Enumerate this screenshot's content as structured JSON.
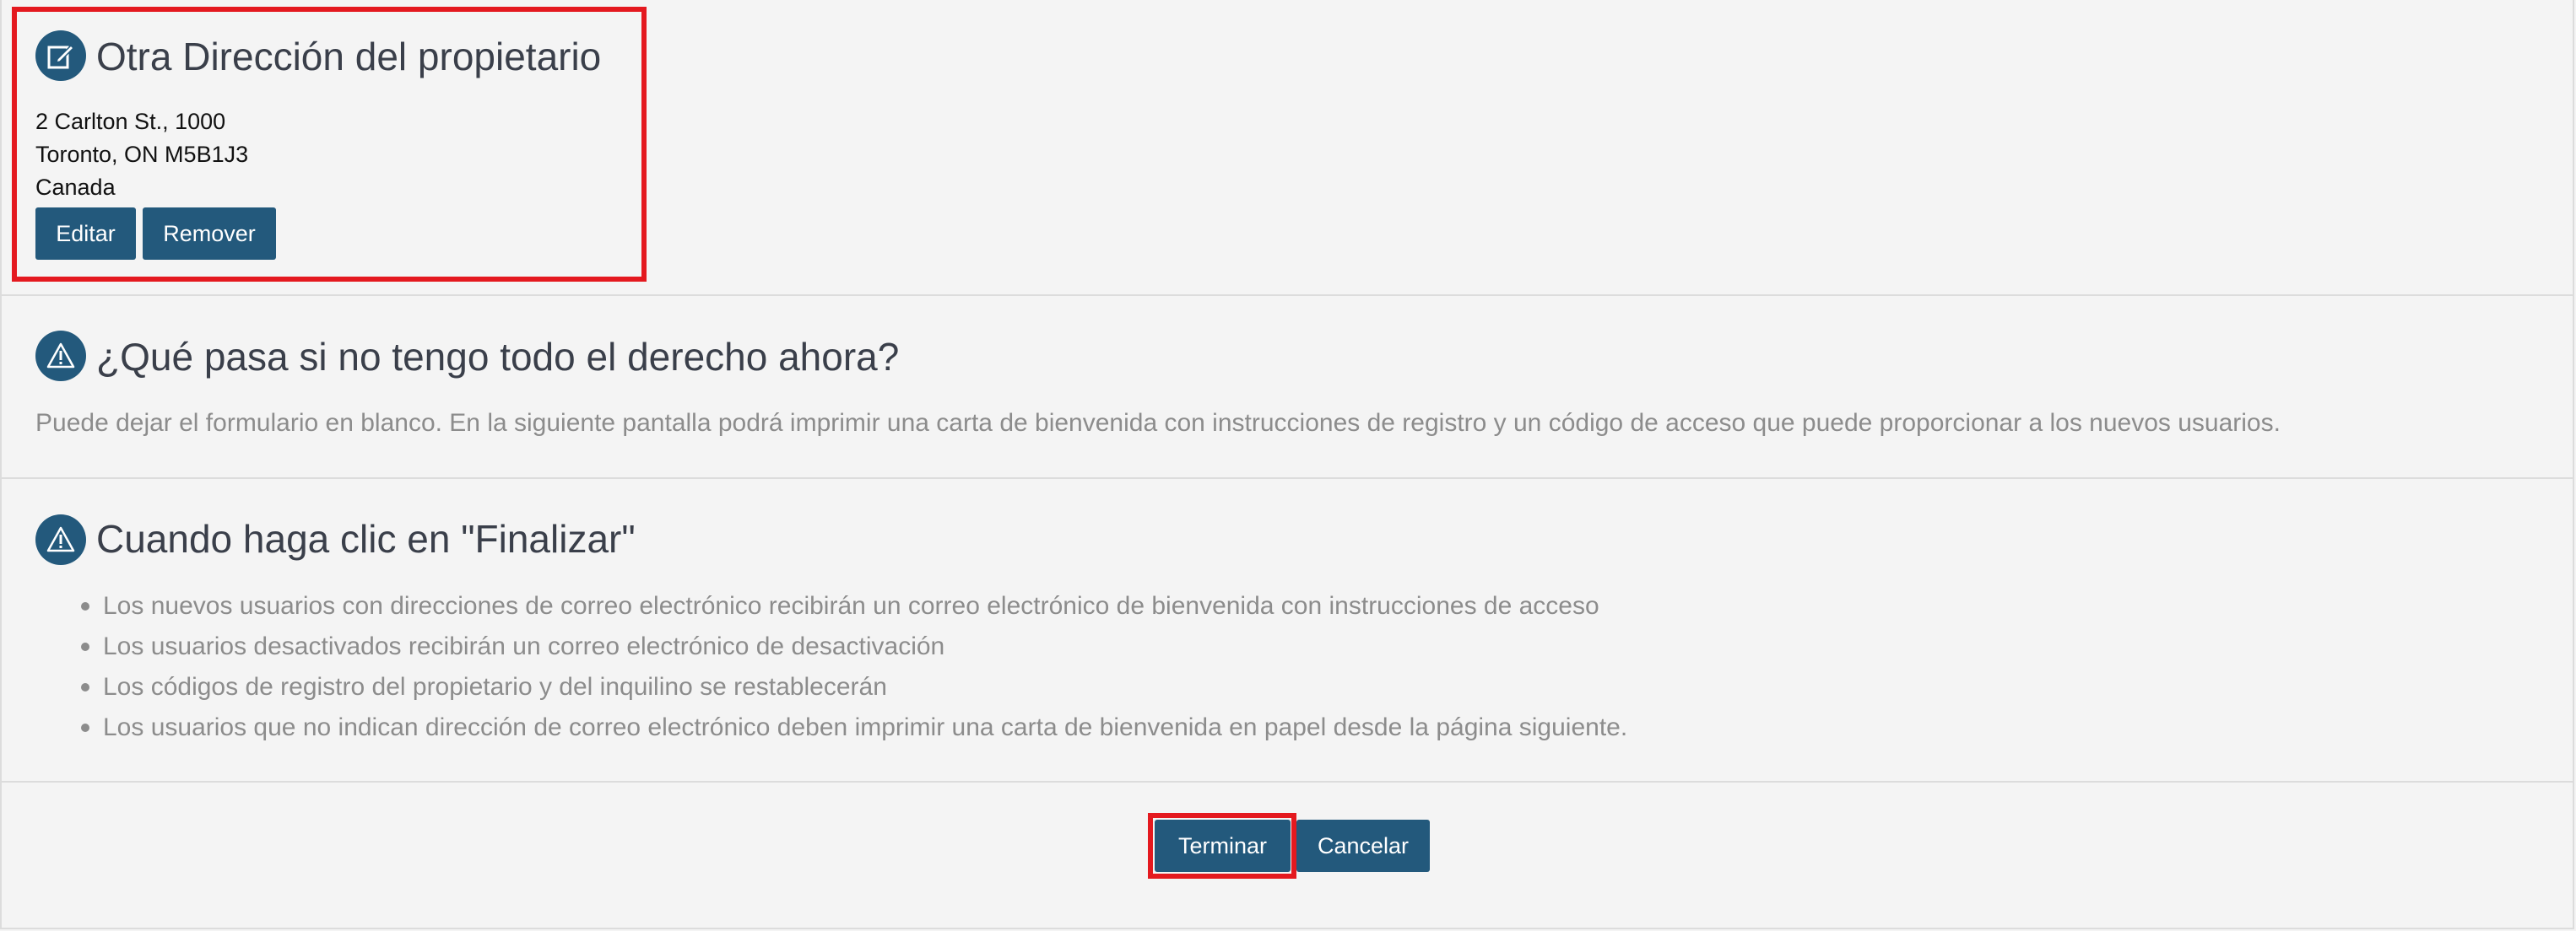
{
  "owner_address": {
    "title": "Otra Dirección del propietario",
    "icon": "edit-icon",
    "lines": [
      "2 Carlton St., 1000",
      "Toronto, ON M5B1J3",
      "Canada"
    ],
    "edit_label": "Editar",
    "remove_label": "Remover"
  },
  "info_section": {
    "title": "¿Qué pasa si no tengo todo el derecho ahora?",
    "icon": "warning-icon",
    "text": "Puede dejar el formulario en blanco. En la siguiente pantalla podrá imprimir una carta de bienvenida con instrucciones de registro y un código de acceso que puede proporcionar a los nuevos usuarios."
  },
  "finish_section": {
    "title": "Cuando haga clic en \"Finalizar\"",
    "icon": "warning-icon",
    "items": [
      "Los nuevos usuarios con direcciones de correo electrónico recibirán un correo electrónico de bienvenida con instrucciones de acceso",
      "Los usuarios desactivados recibirán un correo electrónico de desactivación",
      "Los códigos de registro del propietario y del inquilino se restablecerán",
      "Los usuarios que no indican dirección de correo electrónico deben imprimir una carta de bienvenida en papel desde la página siguiente."
    ]
  },
  "actions": {
    "finish_label": "Terminar",
    "cancel_label": "Cancelar"
  },
  "colors": {
    "primary": "#23597c",
    "highlight": "#e4191f",
    "background": "#f4f4f4",
    "muted_text": "#8c8c8c"
  }
}
